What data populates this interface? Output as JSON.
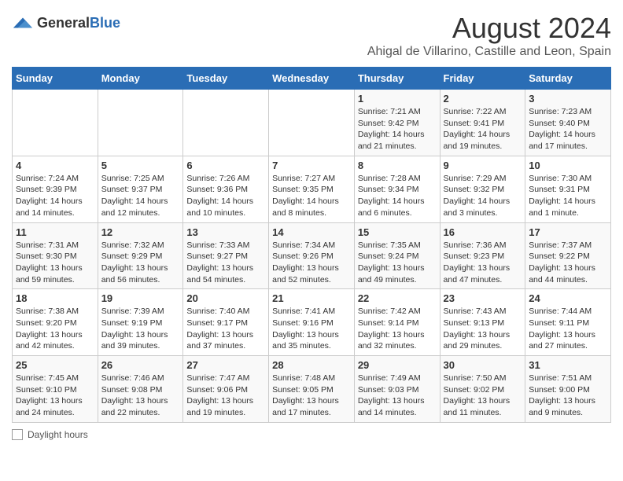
{
  "logo": {
    "general": "General",
    "blue": "Blue"
  },
  "title": "August 2024",
  "subtitle": "Ahigal de Villarino, Castille and Leon, Spain",
  "days_of_week": [
    "Sunday",
    "Monday",
    "Tuesday",
    "Wednesday",
    "Thursday",
    "Friday",
    "Saturday"
  ],
  "footer": {
    "label": "Daylight hours"
  },
  "weeks": [
    [
      {
        "day": "",
        "info": ""
      },
      {
        "day": "",
        "info": ""
      },
      {
        "day": "",
        "info": ""
      },
      {
        "day": "",
        "info": ""
      },
      {
        "day": "1",
        "info": "Sunrise: 7:21 AM\nSunset: 9:42 PM\nDaylight: 14 hours and 21 minutes."
      },
      {
        "day": "2",
        "info": "Sunrise: 7:22 AM\nSunset: 9:41 PM\nDaylight: 14 hours and 19 minutes."
      },
      {
        "day": "3",
        "info": "Sunrise: 7:23 AM\nSunset: 9:40 PM\nDaylight: 14 hours and 17 minutes."
      }
    ],
    [
      {
        "day": "4",
        "info": "Sunrise: 7:24 AM\nSunset: 9:39 PM\nDaylight: 14 hours and 14 minutes."
      },
      {
        "day": "5",
        "info": "Sunrise: 7:25 AM\nSunset: 9:37 PM\nDaylight: 14 hours and 12 minutes."
      },
      {
        "day": "6",
        "info": "Sunrise: 7:26 AM\nSunset: 9:36 PM\nDaylight: 14 hours and 10 minutes."
      },
      {
        "day": "7",
        "info": "Sunrise: 7:27 AM\nSunset: 9:35 PM\nDaylight: 14 hours and 8 minutes."
      },
      {
        "day": "8",
        "info": "Sunrise: 7:28 AM\nSunset: 9:34 PM\nDaylight: 14 hours and 6 minutes."
      },
      {
        "day": "9",
        "info": "Sunrise: 7:29 AM\nSunset: 9:32 PM\nDaylight: 14 hours and 3 minutes."
      },
      {
        "day": "10",
        "info": "Sunrise: 7:30 AM\nSunset: 9:31 PM\nDaylight: 14 hours and 1 minute."
      }
    ],
    [
      {
        "day": "11",
        "info": "Sunrise: 7:31 AM\nSunset: 9:30 PM\nDaylight: 13 hours and 59 minutes."
      },
      {
        "day": "12",
        "info": "Sunrise: 7:32 AM\nSunset: 9:29 PM\nDaylight: 13 hours and 56 minutes."
      },
      {
        "day": "13",
        "info": "Sunrise: 7:33 AM\nSunset: 9:27 PM\nDaylight: 13 hours and 54 minutes."
      },
      {
        "day": "14",
        "info": "Sunrise: 7:34 AM\nSunset: 9:26 PM\nDaylight: 13 hours and 52 minutes."
      },
      {
        "day": "15",
        "info": "Sunrise: 7:35 AM\nSunset: 9:24 PM\nDaylight: 13 hours and 49 minutes."
      },
      {
        "day": "16",
        "info": "Sunrise: 7:36 AM\nSunset: 9:23 PM\nDaylight: 13 hours and 47 minutes."
      },
      {
        "day": "17",
        "info": "Sunrise: 7:37 AM\nSunset: 9:22 PM\nDaylight: 13 hours and 44 minutes."
      }
    ],
    [
      {
        "day": "18",
        "info": "Sunrise: 7:38 AM\nSunset: 9:20 PM\nDaylight: 13 hours and 42 minutes."
      },
      {
        "day": "19",
        "info": "Sunrise: 7:39 AM\nSunset: 9:19 PM\nDaylight: 13 hours and 39 minutes."
      },
      {
        "day": "20",
        "info": "Sunrise: 7:40 AM\nSunset: 9:17 PM\nDaylight: 13 hours and 37 minutes."
      },
      {
        "day": "21",
        "info": "Sunrise: 7:41 AM\nSunset: 9:16 PM\nDaylight: 13 hours and 35 minutes."
      },
      {
        "day": "22",
        "info": "Sunrise: 7:42 AM\nSunset: 9:14 PM\nDaylight: 13 hours and 32 minutes."
      },
      {
        "day": "23",
        "info": "Sunrise: 7:43 AM\nSunset: 9:13 PM\nDaylight: 13 hours and 29 minutes."
      },
      {
        "day": "24",
        "info": "Sunrise: 7:44 AM\nSunset: 9:11 PM\nDaylight: 13 hours and 27 minutes."
      }
    ],
    [
      {
        "day": "25",
        "info": "Sunrise: 7:45 AM\nSunset: 9:10 PM\nDaylight: 13 hours and 24 minutes."
      },
      {
        "day": "26",
        "info": "Sunrise: 7:46 AM\nSunset: 9:08 PM\nDaylight: 13 hours and 22 minutes."
      },
      {
        "day": "27",
        "info": "Sunrise: 7:47 AM\nSunset: 9:06 PM\nDaylight: 13 hours and 19 minutes."
      },
      {
        "day": "28",
        "info": "Sunrise: 7:48 AM\nSunset: 9:05 PM\nDaylight: 13 hours and 17 minutes."
      },
      {
        "day": "29",
        "info": "Sunrise: 7:49 AM\nSunset: 9:03 PM\nDaylight: 13 hours and 14 minutes."
      },
      {
        "day": "30",
        "info": "Sunrise: 7:50 AM\nSunset: 9:02 PM\nDaylight: 13 hours and 11 minutes."
      },
      {
        "day": "31",
        "info": "Sunrise: 7:51 AM\nSunset: 9:00 PM\nDaylight: 13 hours and 9 minutes."
      }
    ]
  ]
}
